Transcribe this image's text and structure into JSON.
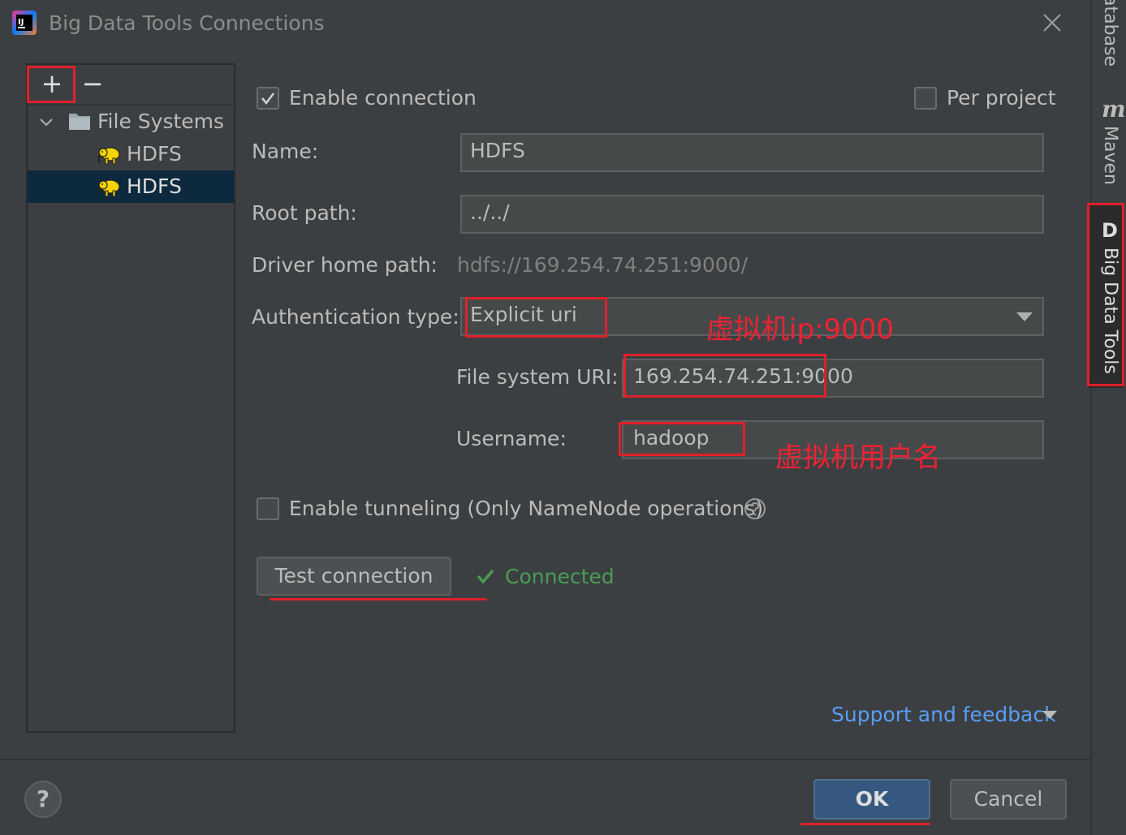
{
  "window": {
    "title": "Big Data Tools Connections"
  },
  "tool_strip": {
    "database_label": "atabase",
    "maven_icon": "m",
    "maven_label": "Maven",
    "bigdata_icon": "D",
    "bigdata_label": "Big Data Tools"
  },
  "tree": {
    "add_label": "+",
    "remove_label": "−",
    "group_label": "File Systems",
    "items": [
      {
        "label": "HDFS",
        "selected": false
      },
      {
        "label": "HDFS",
        "selected": true
      }
    ]
  },
  "form": {
    "enable_connection_label": "Enable connection",
    "enable_connection_checked": true,
    "per_project_label": "Per project",
    "per_project_checked": false,
    "name_label": "Name:",
    "name_value": "HDFS",
    "root_path_label": "Root path:",
    "root_path_value": "../../",
    "driver_home_label": "Driver home path:",
    "driver_home_value": "hdfs://169.254.74.251:9000/",
    "auth_type_label": "Authentication type:",
    "auth_type_value": "Explicit uri",
    "fs_uri_label": "File system URI:",
    "fs_uri_value": "169.254.74.251:9000",
    "username_label": "Username:",
    "username_value": "hadoop",
    "tunneling_label": "Enable tunneling (Only NameNode operations)",
    "tunneling_checked": false,
    "test_connection_label": "Test connection",
    "status_label": "Connected",
    "support_link_label": "Support and feedback"
  },
  "footer": {
    "help_label": "?",
    "ok_label": "OK",
    "cancel_label": "Cancel"
  },
  "annotations": {
    "ip_note": "虚拟机ip:9000",
    "user_note": "虚拟机用户名"
  },
  "colors": {
    "background": "#3c3f41",
    "selection": "#0d293e",
    "accent_blue": "#365880",
    "link": "#589df6",
    "success": "#499c54",
    "annotation_red": "#e0202a"
  }
}
